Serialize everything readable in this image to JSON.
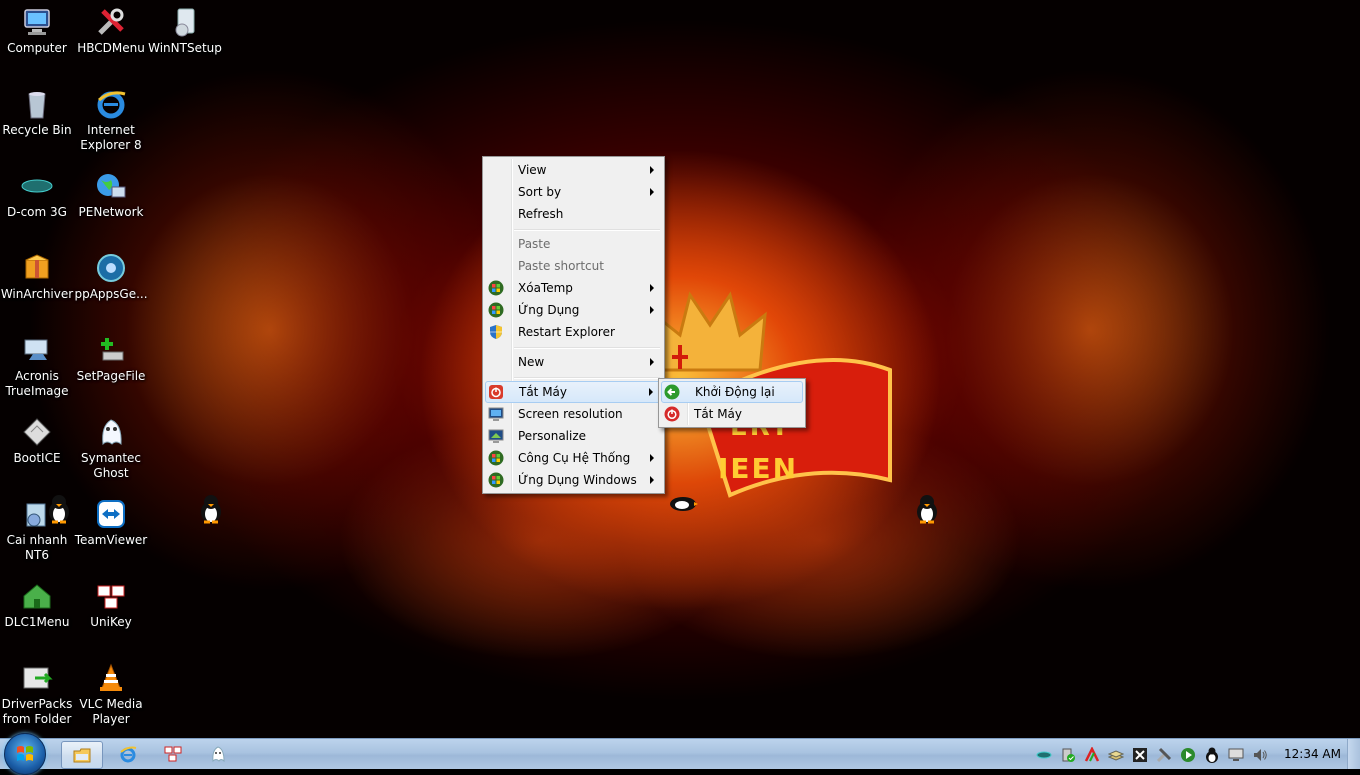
{
  "desktop": {
    "icons": [
      {
        "label": "Computer",
        "icon": "computer-icon"
      },
      {
        "label": "HBCDMenu",
        "icon": "tools-icon"
      },
      {
        "label": "WinNTSetup",
        "icon": "setup-icon"
      },
      {
        "label": "Recycle Bin",
        "icon": "recycle-bin-icon"
      },
      {
        "label": "Internet Explorer 8",
        "icon": "internet-explorer-icon"
      },
      {
        "label": "D-com 3G",
        "icon": "dcom-icon"
      },
      {
        "label": "PENetwork",
        "icon": "network-icon"
      },
      {
        "label": "WinArchiver",
        "icon": "archive-icon"
      },
      {
        "label": "ppAppsGe...",
        "icon": "apps-icon"
      },
      {
        "label": "Acronis TrueImage",
        "icon": "acronis-icon"
      },
      {
        "label": "SetPageFile",
        "icon": "pagefile-icon"
      },
      {
        "label": "BootICE",
        "icon": "bootice-icon"
      },
      {
        "label": "Symantec Ghost",
        "icon": "ghost-icon"
      },
      {
        "label": "Cai nhanh NT6",
        "icon": "install-icon"
      },
      {
        "label": "TeamViewer",
        "icon": "teamviewer-icon"
      },
      {
        "label": "DLC1Menu",
        "icon": "dlc-house-icon"
      },
      {
        "label": "UniKey",
        "icon": "unikey-icon"
      },
      {
        "label": "DriverPacks from Folder",
        "icon": "driverpacks-icon"
      },
      {
        "label": "VLC Media Player",
        "icon": "vlc-icon"
      }
    ],
    "wallpaper_text": [
      "ERY",
      "IEEN"
    ]
  },
  "context_menu": {
    "items": [
      {
        "label": "View",
        "submenu": true
      },
      {
        "label": "Sort by",
        "submenu": true
      },
      {
        "label": "Refresh"
      },
      {
        "label": "Paste",
        "disabled": true
      },
      {
        "label": "Paste shortcut",
        "disabled": true
      },
      {
        "label": "XóaTemp",
        "submenu": true,
        "icon": "windows-orb-icon"
      },
      {
        "label": "Ứng Dụng",
        "submenu": true,
        "icon": "windows-orb-icon"
      },
      {
        "label": "Restart Explorer",
        "icon": "shield-icon"
      },
      {
        "label": "New",
        "submenu": true
      },
      {
        "label": "Tắt Máy",
        "submenu": true,
        "icon": "power-icon",
        "highlighted": true
      },
      {
        "label": "Screen resolution",
        "icon": "monitor-icon"
      },
      {
        "label": "Personalize",
        "icon": "personalize-icon"
      },
      {
        "label": "Công Cụ Hệ Thống",
        "submenu": true,
        "icon": "windows-orb-icon"
      },
      {
        "label": "Ứng Dụng Windows",
        "submenu": true,
        "icon": "windows-orb-icon"
      }
    ]
  },
  "submenu": {
    "items": [
      {
        "label": "Khởi Động lại",
        "icon": "restart-arrow-icon",
        "highlighted": true
      },
      {
        "label": "Tắt Máy",
        "icon": "shutdown-icon"
      }
    ]
  },
  "taskbar": {
    "pinned": [
      "explorer-icon",
      "internet-explorer-icon",
      "unikey-icon",
      "ghost-icon"
    ],
    "tray_icons": [
      "network-icon",
      "safely-remove-icon",
      "antivirus-icon",
      "close-x-icon",
      "tools-icon",
      "stack-icon",
      "penguin-icon",
      "play-icon",
      "shield-icon",
      "display-icon",
      "volume-icon"
    ],
    "clock": "12:34 AM"
  }
}
